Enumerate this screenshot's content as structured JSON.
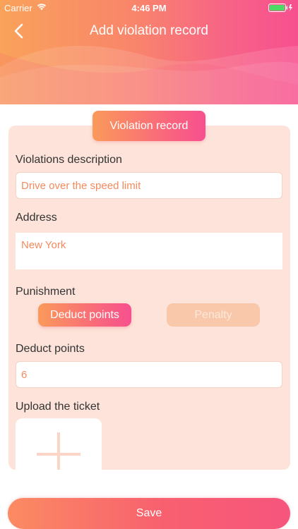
{
  "status_bar": {
    "carrier": "Carrier",
    "time": "4:46 PM"
  },
  "nav": {
    "title": "Add violation record"
  },
  "card": {
    "tab_label": "Violation record",
    "violations_description": {
      "label": "Violations description",
      "value": "Drive over the speed limit"
    },
    "address": {
      "label": "Address",
      "value": "New York"
    },
    "punishment": {
      "label": "Punishment",
      "options": [
        "Deduct points",
        "Penalty"
      ],
      "selected": "Deduct points"
    },
    "deduct_points": {
      "label": "Deduct points",
      "value": "6"
    },
    "upload": {
      "label": "Upload the ticket"
    }
  },
  "save_label": "Save",
  "colors": {
    "accent_start": "#fa9a5b",
    "accent_end": "#f7508f",
    "card_bg": "#fde3d9",
    "input_text": "#f48a5c"
  },
  "icons": {
    "back": "chevron-left-icon",
    "wifi": "wifi-icon",
    "battery": "battery-charging-icon",
    "upload": "plus-icon"
  }
}
